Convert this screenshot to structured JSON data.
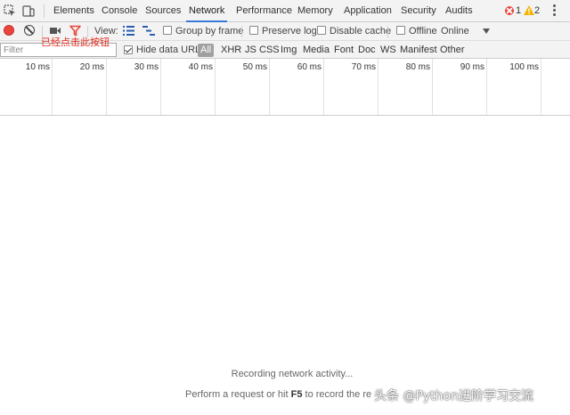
{
  "tabs": [
    {
      "label": "Elements"
    },
    {
      "label": "Console"
    },
    {
      "label": "Sources"
    },
    {
      "label": "Network",
      "active": true
    },
    {
      "label": "Performance"
    },
    {
      "label": "Memory"
    },
    {
      "label": "Application"
    },
    {
      "label": "Security"
    },
    {
      "label": "Audits"
    }
  ],
  "status": {
    "errors": "1",
    "warnings": "2",
    "error_color": "#e8453c",
    "warning_color": "#f4b400"
  },
  "toolbar": {
    "view_label": "View:",
    "group_by_frame": "Group by frame",
    "preserve_log": "Preserve log",
    "disable_cache": "Disable cache",
    "offline": "Offline",
    "throttle": "Online"
  },
  "annotation": "已经点击此按钮",
  "filterbar": {
    "placeholder": "Filter",
    "hide_data_urls": "Hide data URLs",
    "types": [
      "All",
      "XHR",
      "JS",
      "CSS",
      "Img",
      "Media",
      "Font",
      "Doc",
      "WS",
      "Manifest",
      "Other"
    ]
  },
  "timeline": {
    "ticks": [
      "10 ms",
      "20 ms",
      "30 ms",
      "40 ms",
      "50 ms",
      "60 ms",
      "70 ms",
      "80 ms",
      "90 ms",
      "100 ms"
    ]
  },
  "empty": {
    "title": "Recording network activity...",
    "sub_prefix": "Perform a request or hit ",
    "sub_key": "F5",
    "sub_suffix": " to record the re"
  },
  "watermark": "头条 @Python进阶学习交流",
  "colors": {
    "accent": "#3879d9",
    "record": "#e8453c",
    "annotation": "#e52a1c"
  }
}
